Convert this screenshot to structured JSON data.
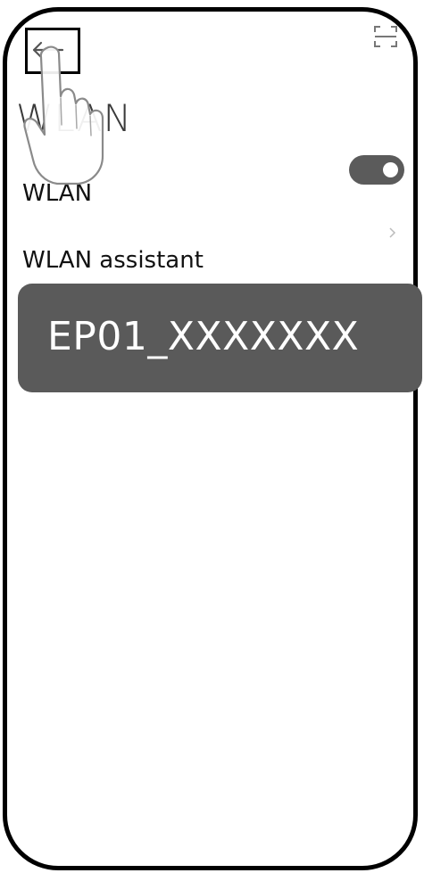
{
  "header": {
    "title": "WLAN",
    "back_icon": "arrow-left-icon",
    "scan_icon": "scan-icon"
  },
  "settings": {
    "wlan_label": "WLAN",
    "wlan_toggle_state": "on",
    "assistant_label": "WLAN assistant"
  },
  "selected_network": {
    "name": "EP01_XXXXXXX"
  },
  "annotation": {
    "pointer_icon": "hand-pointer-icon",
    "highlight_target": "back-button"
  },
  "colors": {
    "frame": "#000000",
    "toggle_on": "#5b5b5b",
    "network_card": "#5a5a5a",
    "network_text": "#ffffff"
  }
}
